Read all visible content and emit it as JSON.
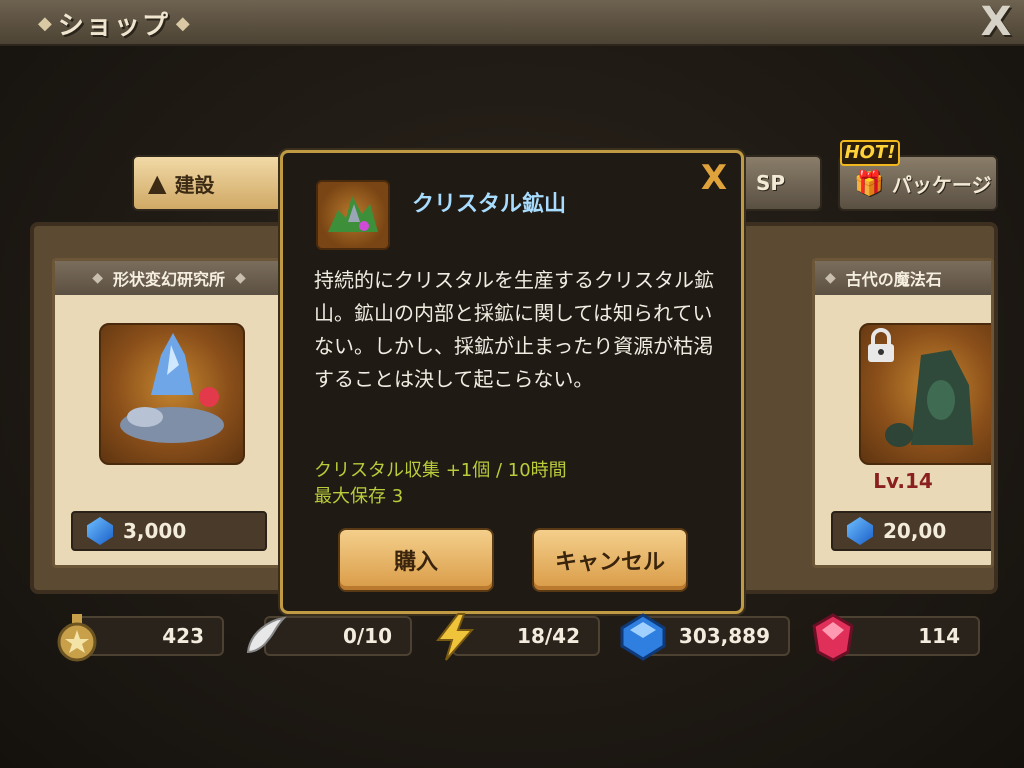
{
  "header": {
    "title": "ショップ",
    "close_label": "X"
  },
  "tabs": [
    {
      "label": "建設",
      "icon": "build-icon",
      "active": true
    },
    {
      "label": "SP",
      "icon": "",
      "active": false
    },
    {
      "label": "パッケージ",
      "icon": "gift-icon",
      "active": false
    }
  ],
  "hot_badge": "HOT!",
  "cards": [
    {
      "name": "形状変幻研究所",
      "price": "3,000",
      "locked": false,
      "level": ""
    },
    {
      "name": "古代の魔法石",
      "price": "20,00",
      "locked": true,
      "level": "Lv.14"
    }
  ],
  "modal": {
    "item_name": "クリスタル鉱山",
    "description": "持続的にクリスタルを生産するクリスタル鉱山。鉱山の内部と採鉱に関しては知られていない。しかし、採鉱が止まったり資源が枯渇することは決して起こらない。",
    "stat_collect": "クリスタル収集 +1個 / 10時間",
    "stat_max": "最大保存 3",
    "buy_label": "購入",
    "cancel_label": "キャンセル",
    "close_label": "X"
  },
  "resources": [
    {
      "name": "medal",
      "value": "423",
      "icon": "medal-icon"
    },
    {
      "name": "wings",
      "value": "0/10",
      "icon": "wing-icon"
    },
    {
      "name": "energy",
      "value": "18/42",
      "icon": "lightning-icon"
    },
    {
      "name": "crystal",
      "value": "303,889",
      "icon": "blue-gem-icon"
    },
    {
      "name": "ruby",
      "value": "114",
      "icon": "red-gem-icon"
    }
  ]
}
